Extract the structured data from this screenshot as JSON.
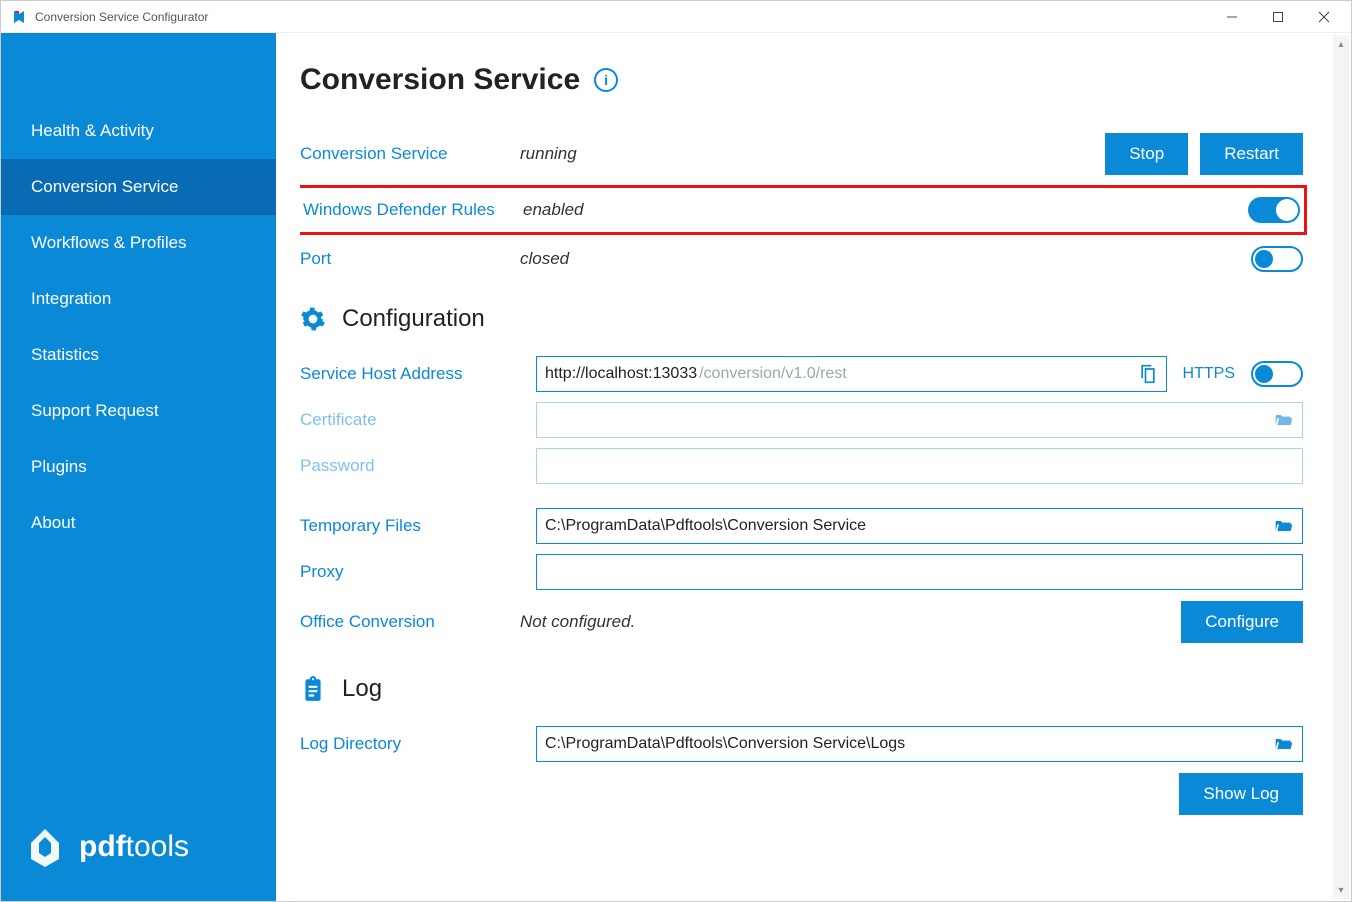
{
  "window": {
    "title": "Conversion Service Configurator"
  },
  "sidebar": {
    "items": [
      {
        "label": "Health & Activity"
      },
      {
        "label": "Conversion Service"
      },
      {
        "label": "Workflows & Profiles"
      },
      {
        "label": "Integration"
      },
      {
        "label": "Statistics"
      },
      {
        "label": "Support Request"
      },
      {
        "label": "Plugins"
      },
      {
        "label": "About"
      }
    ],
    "activeIndex": 1,
    "brand_bold": "pdf",
    "brand_rest": "tools"
  },
  "page": {
    "title": "Conversion Service",
    "service": {
      "label": "Conversion Service",
      "status": "running",
      "stop_btn": "Stop",
      "restart_btn": "Restart"
    },
    "defender": {
      "label": "Windows Defender Rules",
      "status": "enabled",
      "enabled": true
    },
    "port": {
      "label": "Port",
      "status": "closed",
      "open": false
    },
    "config_section": {
      "title": "Configuration",
      "host": {
        "label": "Service Host Address",
        "value": "http://localhost:13033",
        "suffix": "/conversion/v1.0/rest",
        "https_label": "HTTPS",
        "https_on": false
      },
      "certificate": {
        "label": "Certificate",
        "value": ""
      },
      "password": {
        "label": "Password",
        "value": ""
      },
      "tempfiles": {
        "label": "Temporary Files",
        "value": "C:\\ProgramData\\Pdftools\\Conversion Service"
      },
      "proxy": {
        "label": "Proxy",
        "value": ""
      },
      "office": {
        "label": "Office Conversion",
        "status": "Not configured.",
        "configure_btn": "Configure"
      }
    },
    "log_section": {
      "title": "Log",
      "logdir": {
        "label": "Log Directory",
        "value": "C:\\ProgramData\\Pdftools\\Conversion Service\\Logs"
      },
      "showlog_btn": "Show Log"
    }
  }
}
